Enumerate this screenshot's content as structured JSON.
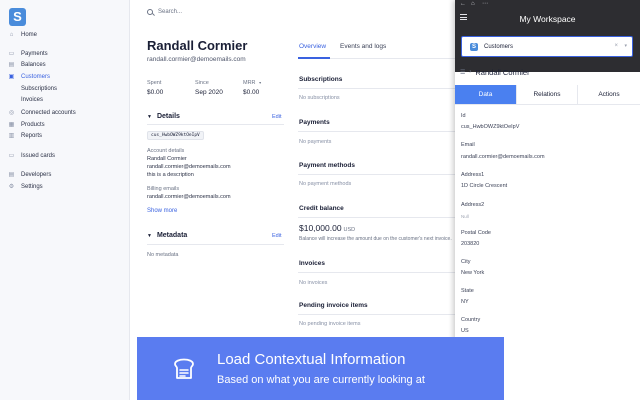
{
  "app": {
    "logo_letter": "S"
  },
  "sidebar": {
    "items": [
      {
        "label": "Home",
        "icon": "home-icon",
        "glyph": "⌂"
      },
      {
        "label": "Payments",
        "icon": "payments-icon",
        "glyph": "▭"
      },
      {
        "label": "Balances",
        "icon": "balances-icon",
        "glyph": "▤"
      },
      {
        "label": "Customers",
        "icon": "customers-icon",
        "glyph": "▣",
        "active": true
      },
      {
        "label": "Subscriptions",
        "sub": true
      },
      {
        "label": "Invoices",
        "sub": true
      },
      {
        "label": "Connected accounts",
        "icon": "connected-accounts-icon",
        "glyph": "◎"
      },
      {
        "label": "Products",
        "icon": "products-icon",
        "glyph": "▦"
      },
      {
        "label": "Reports",
        "icon": "reports-icon",
        "glyph": "▥"
      },
      {
        "label": "Issued cards",
        "icon": "issued-cards-icon",
        "glyph": "▭"
      },
      {
        "label": "Developers",
        "icon": "developers-icon",
        "glyph": "▤"
      },
      {
        "label": "Settings",
        "icon": "settings-icon",
        "glyph": "⚙"
      }
    ]
  },
  "search": {
    "placeholder": "Search..."
  },
  "customer": {
    "name": "Randall Cormier",
    "email": "randall.cormier@demoemails.com",
    "stats": [
      {
        "label": "Spent",
        "value": "$0.00"
      },
      {
        "label": "Since",
        "value": "Sep 2020"
      },
      {
        "label": "MRR",
        "value": "$0.00"
      }
    ],
    "details": {
      "title": "Details",
      "edit": "Edit",
      "id": "cus_HwbOWZ9ktOeIpV",
      "account_label": "Account details",
      "account_name": "Randall Cormier",
      "account_email": "randall.cormier@demoemails.com",
      "description": "this is a description",
      "billing_label": "Billing emails",
      "billing_email": "randall.cormier@demoemails.com",
      "show_more": "Show more"
    },
    "metadata": {
      "title": "Metadata",
      "edit": "Edit",
      "empty": "No metadata"
    }
  },
  "tabs": {
    "overview": "Overview",
    "events": "Events and logs"
  },
  "overview": {
    "subscriptions": {
      "title": "Subscriptions",
      "empty": "No subscriptions"
    },
    "payments": {
      "title": "Payments",
      "empty": "No payments"
    },
    "payment_methods": {
      "title": "Payment methods",
      "empty": "No payment methods"
    },
    "credit": {
      "title": "Credit balance",
      "amount": "$10,000.00",
      "currency": "USD",
      "note": "Balance will increase the amount due on the customer's next invoice."
    },
    "invoices": {
      "title": "Invoices",
      "empty": "No invoices"
    },
    "pending": {
      "title": "Pending invoice items",
      "empty": "No pending invoice items"
    }
  },
  "workspace": {
    "title": "My Workspace",
    "selector": {
      "badge": "S",
      "label": "Customers",
      "clear": "×",
      "chevron": "▾"
    },
    "breadcrumb": "Randall Cormier",
    "tabs": [
      "Data",
      "Relations",
      "Actions"
    ],
    "fields": [
      {
        "label": "Id",
        "value": "cus_HwbOWZ9ktOeIpV"
      },
      {
        "label": "Email",
        "value": "randall.cormier@demoemails.com"
      },
      {
        "label": "Address1",
        "value": "1D Circle Crescent"
      },
      {
        "label": "Address2",
        "value": "Null",
        "null": true
      },
      {
        "label": "Postal Code",
        "value": "203820"
      },
      {
        "label": "City",
        "value": "New York"
      },
      {
        "label": "State",
        "value": "NY"
      },
      {
        "label": "Country",
        "value": "US"
      }
    ]
  },
  "toast": {
    "title": "Load Contextual Information",
    "subtitle": "Based on what you are currently looking at",
    "icon": "bread-icon"
  },
  "colors": {
    "accent": "#3a62e0",
    "toast": "#5a7cf0",
    "panel_header": "#2d2d31",
    "active_tab": "#4a80f0"
  }
}
